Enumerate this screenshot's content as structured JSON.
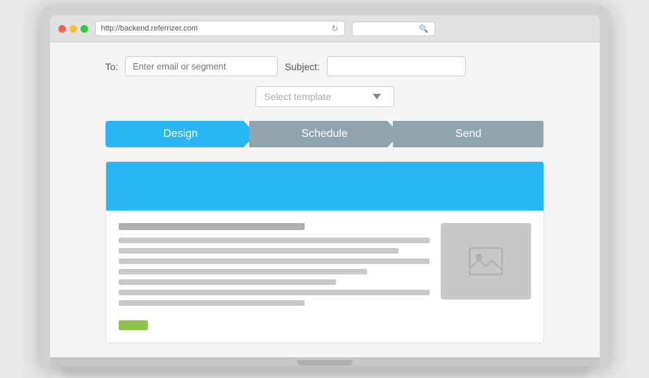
{
  "browser": {
    "url": "http://backend.referrizer.com",
    "refresh_icon": "↻",
    "search_icon": "🔍"
  },
  "form": {
    "to_label": "To:",
    "to_placeholder": "Enter email or segment",
    "subject_label": "Subject:",
    "subject_placeholder": ""
  },
  "template_select": {
    "label": "Select template",
    "arrow": "▼"
  },
  "steps": [
    {
      "label": "Design",
      "active": true
    },
    {
      "label": "Schedule",
      "active": false
    },
    {
      "label": "Send",
      "active": false
    }
  ],
  "email_preview": {
    "header_color": "#29b6f6",
    "image_alt": "image-placeholder"
  },
  "colors": {
    "active_step": "#29b6f6",
    "inactive_step": "#90a4ae",
    "green_tag": "#8bc34a"
  }
}
